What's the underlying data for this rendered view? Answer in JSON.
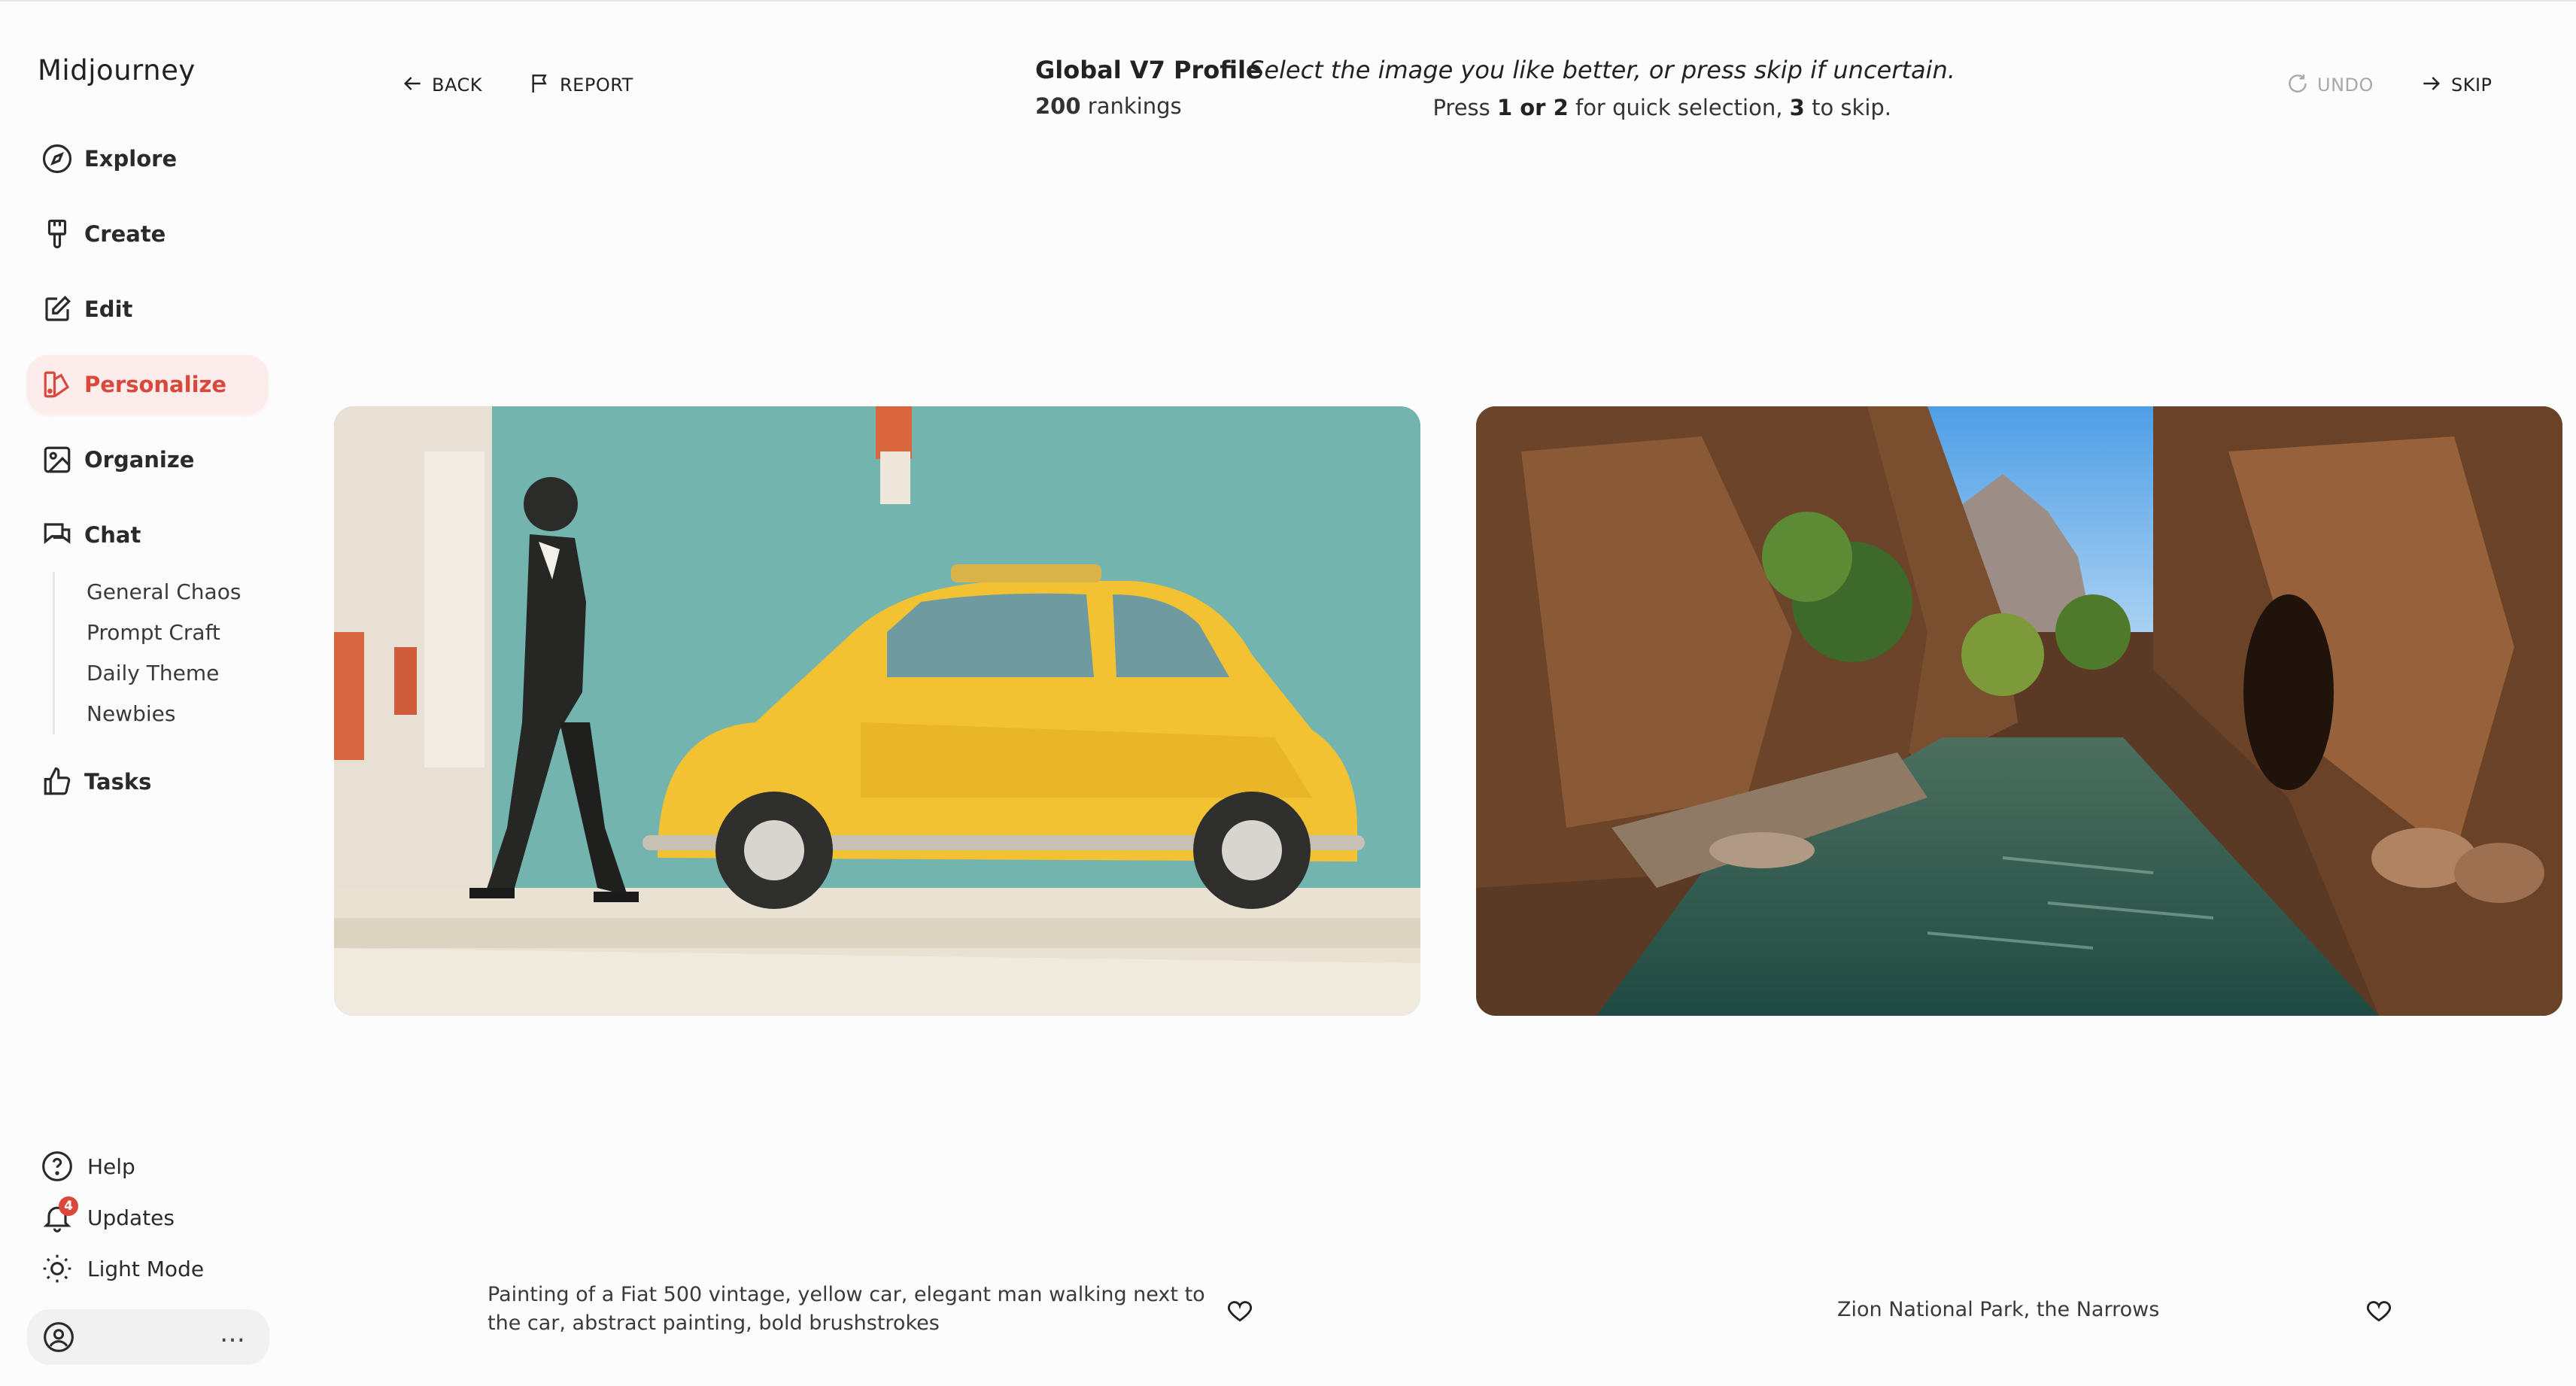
{
  "app": {
    "name": "Midjourney"
  },
  "sidebar": {
    "nav": [
      {
        "label": "Explore",
        "icon": "compass-icon"
      },
      {
        "label": "Create",
        "icon": "paintbrush-icon"
      },
      {
        "label": "Edit",
        "icon": "edit-icon"
      },
      {
        "label": "Personalize",
        "icon": "personalize-icon",
        "active": true
      },
      {
        "label": "Organize",
        "icon": "image-icon"
      },
      {
        "label": "Chat",
        "icon": "chat-icon"
      }
    ],
    "chat_rooms": [
      "General Chaos",
      "Prompt Craft",
      "Daily Theme",
      "Newbies"
    ],
    "tasks": {
      "label": "Tasks",
      "icon": "thumbs-up-icon"
    },
    "help": {
      "label": "Help",
      "icon": "help-icon"
    },
    "updates": {
      "label": "Updates",
      "icon": "bell-icon",
      "badge": "4"
    },
    "theme": {
      "label": "Light Mode",
      "icon": "sun-icon"
    },
    "account": {
      "icon": "user-circle-icon",
      "more": "…"
    }
  },
  "header": {
    "back": "BACK",
    "report": "REPORT",
    "profile_title": "Global V7 Profile",
    "rankings_count": "200",
    "rankings_label": "rankings",
    "instruction": "Select the image you like better, or press skip if uncertain.",
    "hint": {
      "press": "Press",
      "keys12": "1 or 2",
      "mid": "for quick selection,",
      "key3": "3",
      "end": "to skip."
    },
    "undo": "UNDO",
    "skip": "SKIP"
  },
  "options": [
    {
      "caption": "Painting of a Fiat 500 vintage, yellow car, elegant man walking next to the car, abstract painting, bold brushstrokes"
    },
    {
      "caption": "Zion National Park, the Narrows"
    }
  ],
  "colors": {
    "accent": "#d9483b",
    "active_bg": "#fdecec",
    "teal": "#73b3ae",
    "car_yellow": "#f2c232"
  }
}
